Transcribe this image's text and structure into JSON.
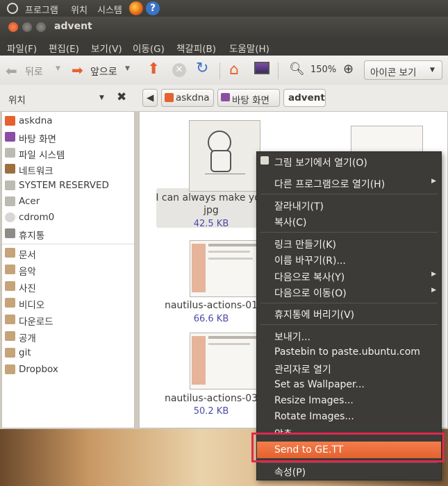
{
  "top_panel": {
    "menus": [
      "프로그램",
      "위치",
      "시스템"
    ]
  },
  "window": {
    "title": "advent"
  },
  "menubar": [
    "파일(F)",
    "편집(E)",
    "보기(V)",
    "이동(G)",
    "책갈피(B)",
    "도움말(H)"
  ],
  "toolbar": {
    "back_label": "뒤로",
    "forward_label": "앞으로",
    "zoom": "150%",
    "view_mode": "아이콘 보기"
  },
  "location": {
    "sidebar_title": "위치",
    "breadcrumbs": [
      "askdna",
      "바탕 화면",
      "advent"
    ]
  },
  "sidebar": {
    "places": [
      "askdna",
      "바탕 화면",
      "파일 시스템",
      "네트워크",
      "SYSTEM RESERVED",
      "Acer",
      "cdrom0",
      "휴지통"
    ],
    "bookmarks": [
      "문서",
      "음악",
      "사진",
      "비디오",
      "다운로드",
      "공개",
      "git",
      "Dropbox"
    ]
  },
  "files": [
    {
      "name_line1": "I can always make you",
      "name_line2": "jpg",
      "size": "42.5 KB"
    },
    {
      "name_line1": "nautilus-actions-01",
      "size": "66.6 KB"
    },
    {
      "name_line1": "nautilus-actions-03",
      "size": "50.2 KB"
    }
  ],
  "context_menu": {
    "items": [
      "그림 보기에서 열기(O)",
      "다른 프로그램으로 열기(H)",
      "잘라내기(T)",
      "복사(C)",
      "링크 만들기(K)",
      "이름 바꾸기(R)...",
      "다음으로 복사(Y)",
      "다음으로 이동(O)",
      "휴지통에 버리기(V)",
      "보내기...",
      "Pastebin to paste.ubuntu.com",
      "관리자로 열기",
      "Set as Wallpaper...",
      "Resize Images...",
      "Rotate Images...",
      "압축",
      "Send to GE.TT",
      "속성(P)"
    ],
    "highlighted": "Send to GE.TT"
  },
  "colors": {
    "accent": "#e3622f",
    "highlight_outline": "#e0284e",
    "panel": "#3c3b37"
  }
}
